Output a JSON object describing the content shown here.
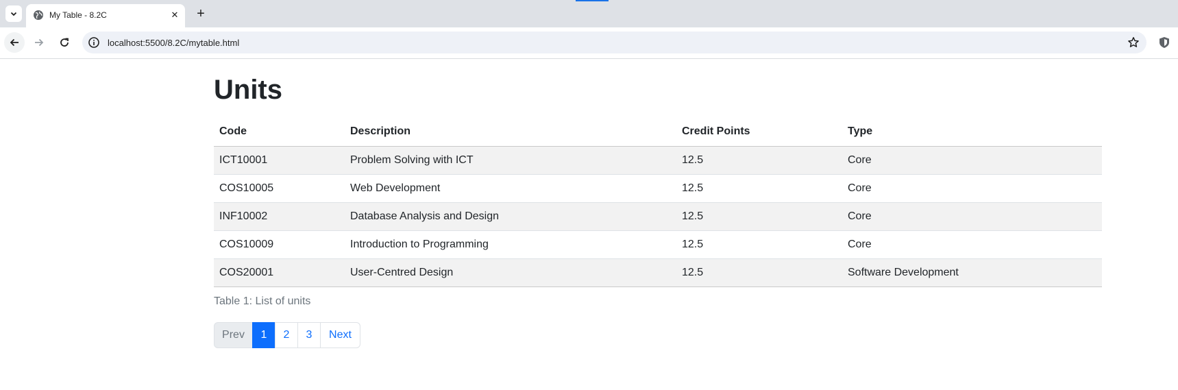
{
  "browser": {
    "tab": {
      "title": "My Table - 8.2C"
    },
    "url": "localhost:5500/8.2C/mytable.html",
    "accent_color": "#1a73e8"
  },
  "page": {
    "title": "Units",
    "table": {
      "headers": [
        "Code",
        "Description",
        "Credit Points",
        "Type"
      ],
      "rows": [
        [
          "ICT10001",
          "Problem Solving with ICT",
          "12.5",
          "Core"
        ],
        [
          "COS10005",
          "Web Development",
          "12.5",
          "Core"
        ],
        [
          "INF10002",
          "Database Analysis and Design",
          "12.5",
          "Core"
        ],
        [
          "COS10009",
          "Introduction to Programming",
          "12.5",
          "Core"
        ],
        [
          "COS20001",
          "User-Centred Design",
          "12.5",
          "Software Development"
        ]
      ]
    },
    "caption": "Table 1: List of units",
    "pagination": {
      "prev": "Prev",
      "pages": [
        "1",
        "2",
        "3"
      ],
      "active_page": "1",
      "next": "Next",
      "active_color": "#0d6efd"
    }
  }
}
